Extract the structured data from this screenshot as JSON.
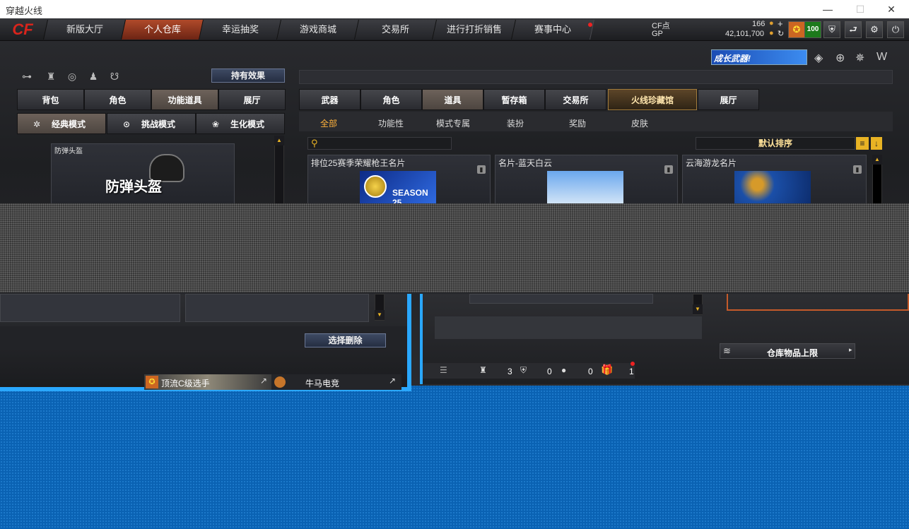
{
  "window": {
    "title": "穿越火线",
    "minimize": "—",
    "maximize": "☐",
    "close": "✕"
  },
  "nav": {
    "logo": "CF",
    "tabs": [
      {
        "label": "新版大厅",
        "active": false
      },
      {
        "label": "个人仓库",
        "active": true
      },
      {
        "label": "幸运抽奖",
        "active": false
      },
      {
        "label": "游戏商城",
        "active": false
      },
      {
        "label": "交易所",
        "active": false
      },
      {
        "label": "进行打折销售",
        "active": false
      },
      {
        "label": "赛事中心",
        "active": false
      }
    ],
    "cf_label": "CF点",
    "cf_value": "166",
    "gp_label": "GP",
    "gp_value": "42,101,700",
    "level_badge": "100"
  },
  "left_panel": {
    "effect_button": "持有效果",
    "tabs": [
      "背包",
      "角色",
      "功能道具",
      "展厅"
    ],
    "active_tab": 2,
    "modes": [
      "经典模式",
      "挑战模式",
      "生化模式"
    ],
    "item_name": "防弹头盔",
    "item_big_label": "防弹头盔",
    "delete_button": "选择删除",
    "players": [
      "顶流C级选手",
      "牛马电竞"
    ]
  },
  "right_panel": {
    "banner": "成长武器!",
    "tabs": [
      "武器",
      "角色",
      "道具",
      "暂存箱",
      "交易所",
      "火线珍藏馆",
      "展厅"
    ],
    "active_tab": 2,
    "collect_tab": 5,
    "subtabs": [
      "全部",
      "功能性",
      "模式专属",
      "装扮",
      "奖励",
      "皮肤"
    ],
    "active_subtab": 0,
    "sort_label": "默认排序",
    "cards": [
      {
        "name": "排位25赛季荣耀枪王名片",
        "img_text": "SEASON 25"
      },
      {
        "name": "名片-蓝天白云",
        "img_text": ""
      },
      {
        "name": "云海游龙名片",
        "img_text": ""
      }
    ],
    "status_counts": [
      "3",
      "0",
      "0",
      "1"
    ],
    "storage_limit": "仓库物品上限"
  },
  "colors": {
    "accent": "#2aa8ff",
    "active_tab": "#b04a2a",
    "gold": "#ffb23c"
  }
}
